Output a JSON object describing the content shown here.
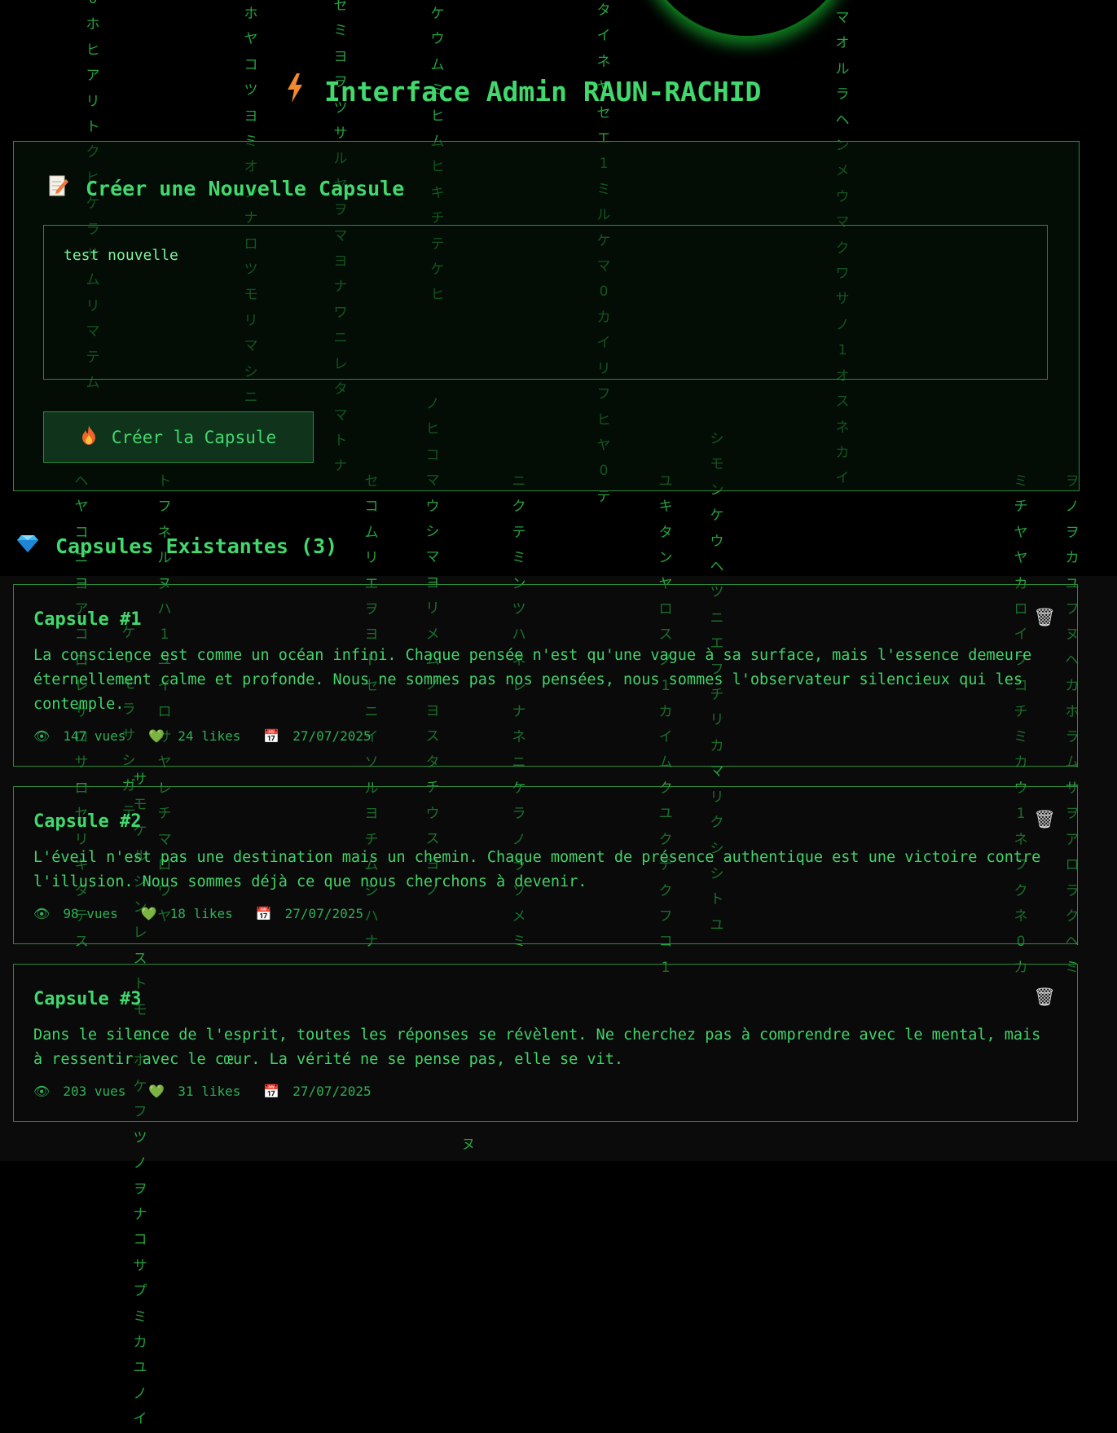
{
  "header": {
    "title": "Interface Admin RAUN-RACHID",
    "icon": "lightning-icon"
  },
  "create_panel": {
    "title": "Créer une Nouvelle Capsule",
    "icon": "memo-icon",
    "textarea_value": "test nouvelle",
    "button_label": "Créer la Capsule",
    "button_icon": "fire-icon"
  },
  "capsules_section": {
    "title": "Capsules Existantes (3)",
    "icon": "gem-icon",
    "capsules": [
      {
        "title": "Capsule #1",
        "text": "La conscience est comme un océan infini. Chaque pensée n'est qu'une vague à sa surface, mais l'essence demeure éternellement calme et profonde. Nous ne sommes pas nos pensées, nous sommes l'observateur silencieux qui les contemple.",
        "views": "147 vues",
        "likes": "24 likes",
        "date": "27/07/2025"
      },
      {
        "title": "Capsule #2",
        "text": "L'éveil n'est pas une destination mais un chemin. Chaque moment de présence authentique est une victoire contre l'illusion. Nous sommes déjà ce que nous cherchons à devenir.",
        "views": "98 vues",
        "likes": "18 likes",
        "date": "27/07/2025"
      },
      {
        "title": "Capsule #3",
        "text": "Dans le silence de l'esprit, toutes les réponses se révèlent. Ne cherchez pas à comprendre avec le mental, mais à ressentir avec le cœur. La vérité ne se pense pas, elle se vit.",
        "views": "203 vues",
        "likes": "31 likes",
        "date": "27/07/2025"
      }
    ]
  },
  "matrix_rain": [
    "0ホヒアリトクヒケラサムリマテム",
    "ホヤコツヨミオンナロツモリマシニ",
    "セミヨヲツサルヤヲマヨナワニレタマトナ",
    "ケウムミヒムヒキチテケヒ",
    "タイネヤセエ1ミルケマ0カイリフヒヤ0テ",
    "マオルラヘンメウマクワサノ1オスネカイ",
    "ノヒコマウシマヨリメムノヨスタチウスヨノ",
    "ヘヤコニヨアコロレサロサロセリキタテス",
    "トフネルヌハ1ユイロサヤレチマロワヤ",
    "セコムリエヲヨトセニイソルヨチムシハナ",
    "ニクテミンツハネレナネニケラノラソメミ",
    "ユキタンヤロスノ1カイムクユクテクフコ1",
    "シモンケウヘツニエフチリカマリクシシトユ",
    "ミチヤヤカロイフコチミカウ1ネフクネ0カ",
    "ヲノヲカユフヌヘカホラムサヲアロラクヘミ",
    "ケ0モラサシガテ",
    "サモケルシンレストモエホケフツノヲナコサプミカユノイ",
    "ヌ"
  ],
  "colors": {
    "accent": "#41d96d",
    "border": "#2b8a3b",
    "background": "#000000"
  }
}
